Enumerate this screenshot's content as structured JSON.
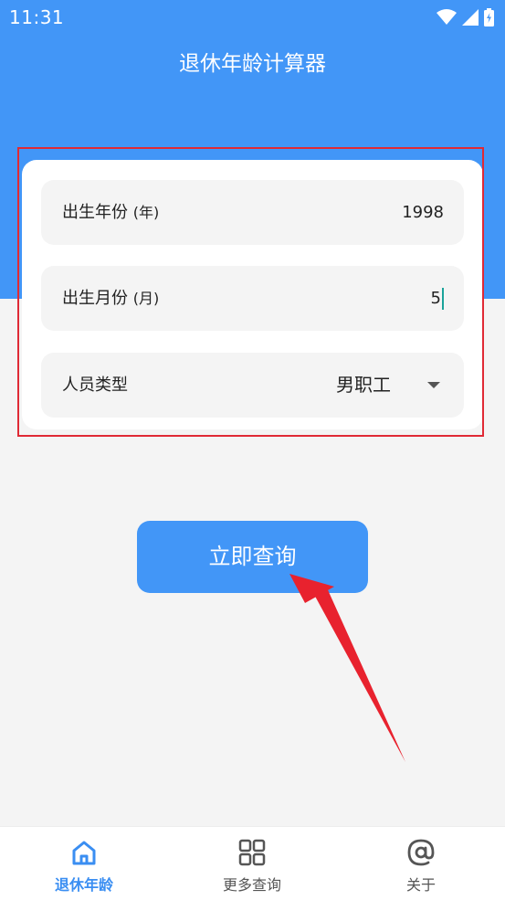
{
  "status_bar": {
    "time": "11:31"
  },
  "header": {
    "title": "退休年龄计算器"
  },
  "form": {
    "birth_year": {
      "label": "出生年份",
      "unit": "(年)",
      "value": "1998"
    },
    "birth_month": {
      "label": "出生月份",
      "unit": "(月)",
      "value": "5"
    },
    "person_type": {
      "label": "人员类型",
      "selected": "男职工"
    }
  },
  "query_button": {
    "label": "立即查询"
  },
  "bottom_nav": {
    "items": [
      {
        "label": "退休年龄",
        "icon": "home-icon",
        "active": true
      },
      {
        "label": "更多查询",
        "icon": "grid-icon",
        "active": false
      },
      {
        "label": "关于",
        "icon": "at-icon",
        "active": false
      }
    ]
  },
  "colors": {
    "primary": "#4296f7",
    "annotation_red": "#e02a35",
    "nav_active": "#3a8ef2"
  }
}
